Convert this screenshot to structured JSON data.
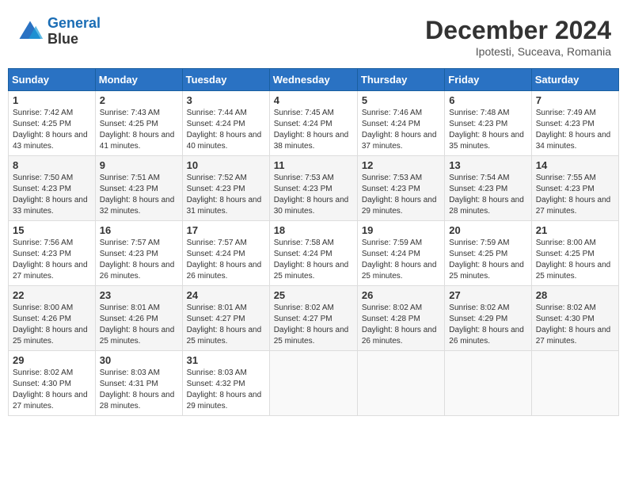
{
  "header": {
    "logo_line1": "General",
    "logo_line2": "Blue",
    "month": "December 2024",
    "location": "Ipotesti, Suceava, Romania"
  },
  "weekdays": [
    "Sunday",
    "Monday",
    "Tuesday",
    "Wednesday",
    "Thursday",
    "Friday",
    "Saturday"
  ],
  "weeks": [
    [
      {
        "day": "1",
        "sunrise": "7:42 AM",
        "sunset": "4:25 PM",
        "daylight": "8 hours and 43 minutes."
      },
      {
        "day": "2",
        "sunrise": "7:43 AM",
        "sunset": "4:25 PM",
        "daylight": "8 hours and 41 minutes."
      },
      {
        "day": "3",
        "sunrise": "7:44 AM",
        "sunset": "4:24 PM",
        "daylight": "8 hours and 40 minutes."
      },
      {
        "day": "4",
        "sunrise": "7:45 AM",
        "sunset": "4:24 PM",
        "daylight": "8 hours and 38 minutes."
      },
      {
        "day": "5",
        "sunrise": "7:46 AM",
        "sunset": "4:24 PM",
        "daylight": "8 hours and 37 minutes."
      },
      {
        "day": "6",
        "sunrise": "7:48 AM",
        "sunset": "4:23 PM",
        "daylight": "8 hours and 35 minutes."
      },
      {
        "day": "7",
        "sunrise": "7:49 AM",
        "sunset": "4:23 PM",
        "daylight": "8 hours and 34 minutes."
      }
    ],
    [
      {
        "day": "8",
        "sunrise": "7:50 AM",
        "sunset": "4:23 PM",
        "daylight": "8 hours and 33 minutes."
      },
      {
        "day": "9",
        "sunrise": "7:51 AM",
        "sunset": "4:23 PM",
        "daylight": "8 hours and 32 minutes."
      },
      {
        "day": "10",
        "sunrise": "7:52 AM",
        "sunset": "4:23 PM",
        "daylight": "8 hours and 31 minutes."
      },
      {
        "day": "11",
        "sunrise": "7:53 AM",
        "sunset": "4:23 PM",
        "daylight": "8 hours and 30 minutes."
      },
      {
        "day": "12",
        "sunrise": "7:53 AM",
        "sunset": "4:23 PM",
        "daylight": "8 hours and 29 minutes."
      },
      {
        "day": "13",
        "sunrise": "7:54 AM",
        "sunset": "4:23 PM",
        "daylight": "8 hours and 28 minutes."
      },
      {
        "day": "14",
        "sunrise": "7:55 AM",
        "sunset": "4:23 PM",
        "daylight": "8 hours and 27 minutes."
      }
    ],
    [
      {
        "day": "15",
        "sunrise": "7:56 AM",
        "sunset": "4:23 PM",
        "daylight": "8 hours and 27 minutes."
      },
      {
        "day": "16",
        "sunrise": "7:57 AM",
        "sunset": "4:23 PM",
        "daylight": "8 hours and 26 minutes."
      },
      {
        "day": "17",
        "sunrise": "7:57 AM",
        "sunset": "4:24 PM",
        "daylight": "8 hours and 26 minutes."
      },
      {
        "day": "18",
        "sunrise": "7:58 AM",
        "sunset": "4:24 PM",
        "daylight": "8 hours and 25 minutes."
      },
      {
        "day": "19",
        "sunrise": "7:59 AM",
        "sunset": "4:24 PM",
        "daylight": "8 hours and 25 minutes."
      },
      {
        "day": "20",
        "sunrise": "7:59 AM",
        "sunset": "4:25 PM",
        "daylight": "8 hours and 25 minutes."
      },
      {
        "day": "21",
        "sunrise": "8:00 AM",
        "sunset": "4:25 PM",
        "daylight": "8 hours and 25 minutes."
      }
    ],
    [
      {
        "day": "22",
        "sunrise": "8:00 AM",
        "sunset": "4:26 PM",
        "daylight": "8 hours and 25 minutes."
      },
      {
        "day": "23",
        "sunrise": "8:01 AM",
        "sunset": "4:26 PM",
        "daylight": "8 hours and 25 minutes."
      },
      {
        "day": "24",
        "sunrise": "8:01 AM",
        "sunset": "4:27 PM",
        "daylight": "8 hours and 25 minutes."
      },
      {
        "day": "25",
        "sunrise": "8:02 AM",
        "sunset": "4:27 PM",
        "daylight": "8 hours and 25 minutes."
      },
      {
        "day": "26",
        "sunrise": "8:02 AM",
        "sunset": "4:28 PM",
        "daylight": "8 hours and 26 minutes."
      },
      {
        "day": "27",
        "sunrise": "8:02 AM",
        "sunset": "4:29 PM",
        "daylight": "8 hours and 26 minutes."
      },
      {
        "day": "28",
        "sunrise": "8:02 AM",
        "sunset": "4:30 PM",
        "daylight": "8 hours and 27 minutes."
      }
    ],
    [
      {
        "day": "29",
        "sunrise": "8:02 AM",
        "sunset": "4:30 PM",
        "daylight": "8 hours and 27 minutes."
      },
      {
        "day": "30",
        "sunrise": "8:03 AM",
        "sunset": "4:31 PM",
        "daylight": "8 hours and 28 minutes."
      },
      {
        "day": "31",
        "sunrise": "8:03 AM",
        "sunset": "4:32 PM",
        "daylight": "8 hours and 29 minutes."
      },
      null,
      null,
      null,
      null
    ]
  ]
}
